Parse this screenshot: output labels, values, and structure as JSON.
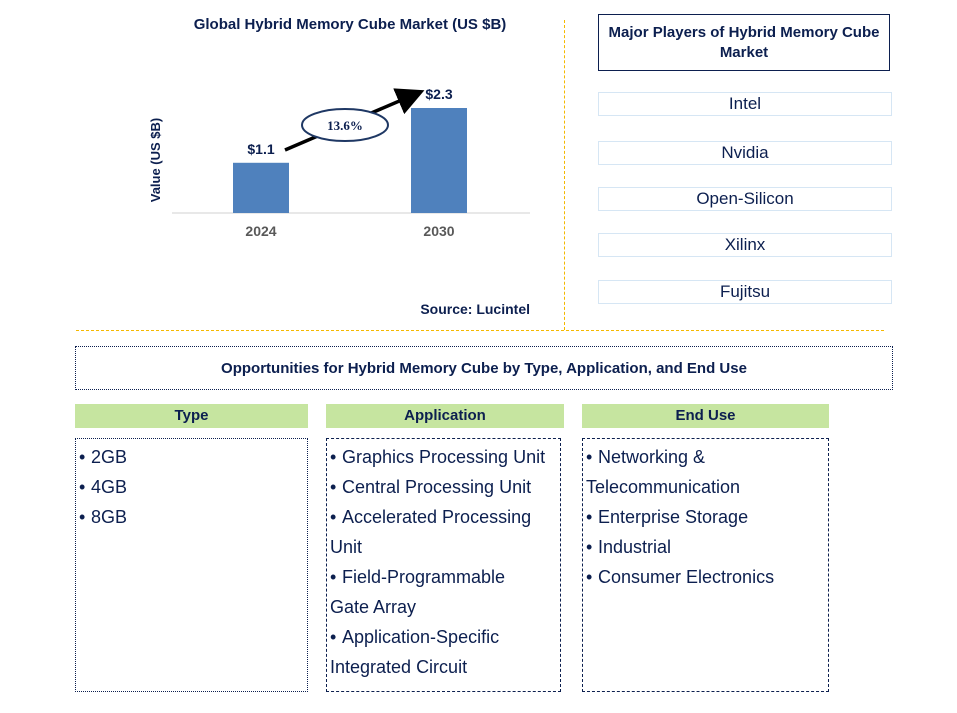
{
  "chart_data": {
    "type": "bar",
    "title": "Global Hybrid Memory Cube Market (US $B)",
    "xlabel": "",
    "ylabel": "Value (US $B)",
    "categories": [
      "2024",
      "2030"
    ],
    "values": [
      1.1,
      2.3
    ],
    "data_labels": [
      "$1.1",
      "$2.3"
    ],
    "ylim": [
      0,
      2.3
    ],
    "grid": false,
    "bar_color": "#4f81bd",
    "annotation": {
      "text": "13.6%",
      "meaning": "CAGR 2024-2030",
      "shape": "ellipse-with-arrow"
    }
  },
  "source": "Source: Lucintel",
  "players": {
    "title": "Major Players of Hybrid Memory Cube Market",
    "items": [
      "Intel",
      "Nvidia",
      "Open-Silicon",
      "Xilinx",
      "Fujitsu"
    ]
  },
  "opportunities": {
    "title": "Opportunities for Hybrid Memory Cube by Type, Application, and End Use",
    "columns": [
      {
        "header": "Type",
        "items": [
          [
            "2GB"
          ],
          [
            "4GB"
          ],
          [
            "8GB"
          ]
        ]
      },
      {
        "header": "Application",
        "items": [
          [
            "Graphics Processing Unit"
          ],
          [
            "Central Processing Unit"
          ],
          [
            "Accelerated Processing",
            "Unit"
          ],
          [
            "Field-Programmable",
            "Gate Array"
          ],
          [
            "Application-Specific",
            "Integrated Circuit"
          ]
        ]
      },
      {
        "header": "End Use",
        "items": [
          [
            "Networking &",
            "Telecommunication"
          ],
          [
            "Enterprise Storage"
          ],
          [
            "Industrial"
          ],
          [
            "Consumer Electronics"
          ]
        ]
      }
    ]
  },
  "colors": {
    "text_dark": "#0c1f4f",
    "bar": "#4f81bd",
    "header_green": "#c6e5a0",
    "divider_gold": "#f5b800",
    "player_border": "#d6e6f4"
  }
}
